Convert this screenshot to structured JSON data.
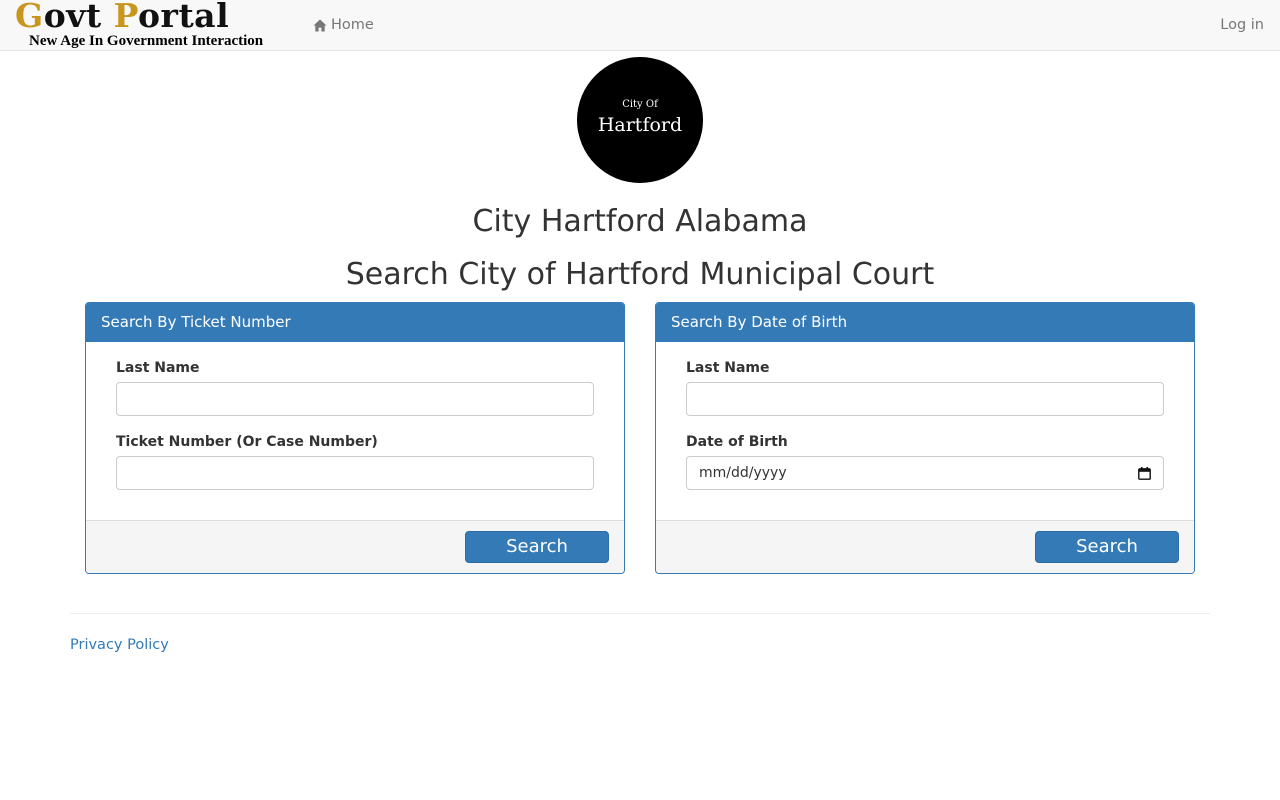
{
  "navbar": {
    "brand": {
      "title_part1": "G",
      "title_part2": "ovt ",
      "title_part3": "P",
      "title_part4": "ortal",
      "tagline": "New Age In Government Interaction"
    },
    "home_label": "Home",
    "login_label": "Log in"
  },
  "seal": {
    "small_text": "City Of",
    "big_text": "Hartford"
  },
  "main": {
    "city_title": "City Hartford Alabama",
    "court_title": "Search City of Hartford Municipal Court"
  },
  "ticket_panel": {
    "heading": "Search By Ticket Number",
    "last_name_label": "Last Name",
    "last_name_value": "",
    "ticket_label": "Ticket Number (Or Case Number)",
    "ticket_value": "",
    "search_label": "Search"
  },
  "dob_panel": {
    "heading": "Search By Date of Birth",
    "last_name_label": "Last Name",
    "last_name_value": "",
    "dob_label": "Date of Birth",
    "dob_placeholder": "mm/dd/yyyy",
    "search_label": "Search"
  },
  "footer": {
    "privacy_label": "Privacy Policy"
  },
  "colors": {
    "primary": "#337ab7",
    "brand_gold": "#c8961e",
    "navbar_bg": "#f8f8f8",
    "footer_bg": "#f5f5f5"
  }
}
